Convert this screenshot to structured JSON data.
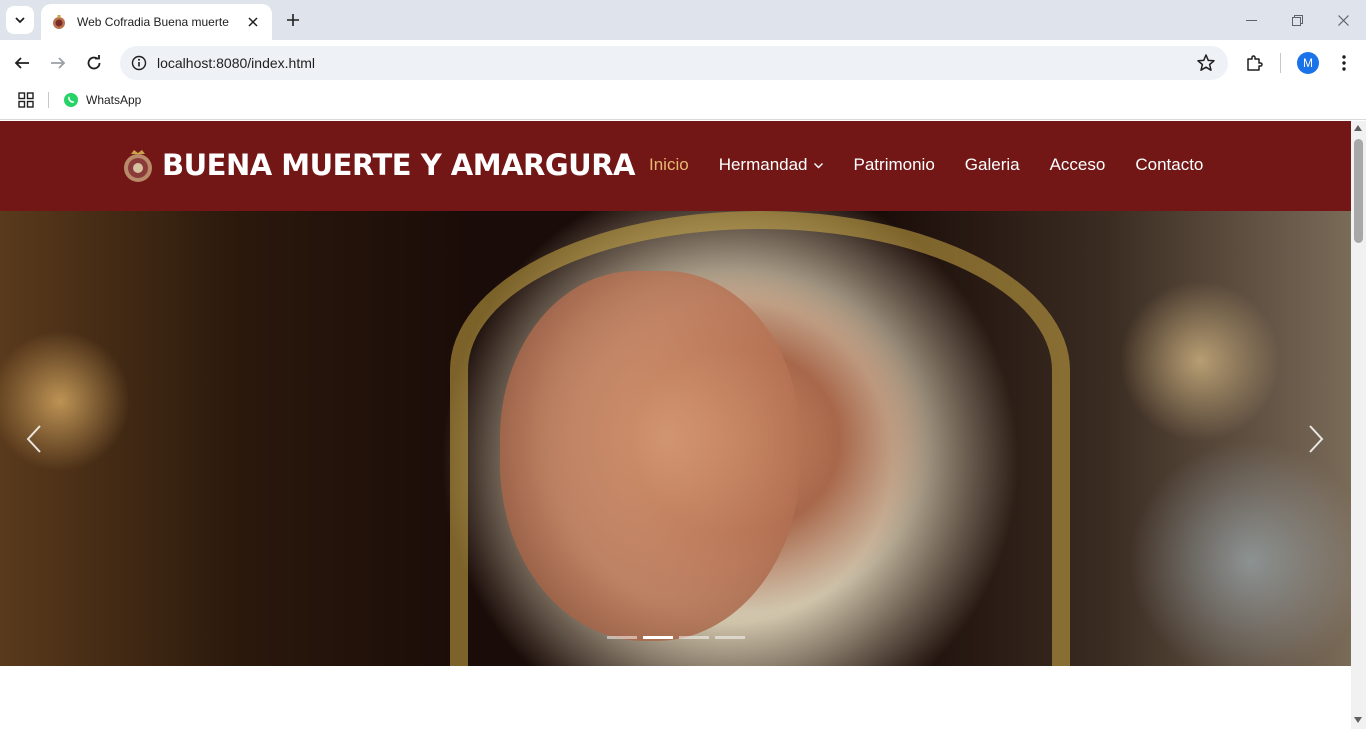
{
  "browser": {
    "tab": {
      "title": "Web Cofradia Buena muerte",
      "favicon": "cofradia-emblem-icon"
    },
    "address_bar": {
      "url": "localhost:8080/index.html"
    },
    "profile_initial": "M",
    "bookmarks": [
      {
        "label": "WhatsApp",
        "icon": "whatsapp-icon"
      }
    ]
  },
  "site": {
    "brand": "BUENA MUERTE Y AMARGURA",
    "nav": [
      {
        "label": "Inicio",
        "active": true
      },
      {
        "label": "Hermandad",
        "dropdown": true
      },
      {
        "label": "Patrimonio"
      },
      {
        "label": "Galeria"
      },
      {
        "label": "Acceso"
      },
      {
        "label": "Contacto"
      }
    ],
    "colors": {
      "header_bg": "#721616",
      "nav_active": "#e6b872",
      "nav_text": "#ffffff"
    }
  },
  "carousel": {
    "slide_count": 4,
    "active_index": 1,
    "image": "Virgin of Amargura image"
  }
}
